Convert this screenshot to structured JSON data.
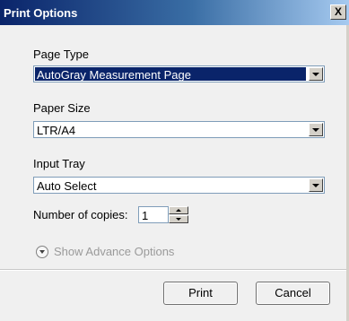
{
  "window": {
    "title": "Print Options",
    "close_label": "X"
  },
  "page_type": {
    "label": "Page Type",
    "value": "AutoGray Measurement Page"
  },
  "paper_size": {
    "label": "Paper Size",
    "value": "LTR/A4"
  },
  "input_tray": {
    "label": "Input Tray",
    "value": "Auto Select"
  },
  "copies": {
    "label": "Number of copies:",
    "value": "1"
  },
  "advanced": {
    "label": "Show Advance Options"
  },
  "buttons": {
    "print": "Print",
    "cancel": "Cancel"
  },
  "colors": {
    "titlebar": "#0a246a",
    "selection": "#0a246a"
  }
}
